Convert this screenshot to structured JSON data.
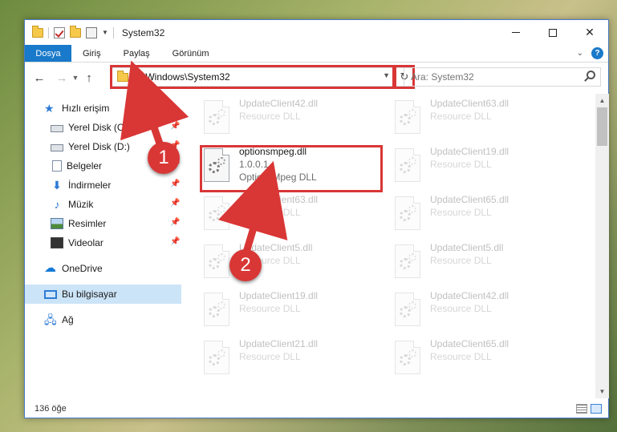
{
  "window": {
    "title": "System32"
  },
  "ribbon": {
    "tabs": [
      "Dosya",
      "Giriş",
      "Paylaş",
      "Görünüm"
    ],
    "help": "?"
  },
  "address": {
    "path": "C:\\Windows\\System32"
  },
  "search": {
    "placeholder": "Ara: System32"
  },
  "sidebar": {
    "items": [
      {
        "label": "Hızlı erişim",
        "icon": "star-icon"
      },
      {
        "label": "Yerel Disk (C:)",
        "icon": "disk-icon",
        "pinned": true
      },
      {
        "label": "Yerel Disk (D:)",
        "icon": "disk-icon",
        "pinned": true
      },
      {
        "label": "Belgeler",
        "icon": "document-icon",
        "pinned": true
      },
      {
        "label": "İndirmeler",
        "icon": "download-icon",
        "pinned": true
      },
      {
        "label": "Müzik",
        "icon": "music-icon",
        "pinned": true
      },
      {
        "label": "Resimler",
        "icon": "pictures-icon",
        "pinned": true
      },
      {
        "label": "Videolar",
        "icon": "video-icon",
        "pinned": true
      },
      {
        "label": "OneDrive",
        "icon": "cloud-icon"
      },
      {
        "label": "Bu bilgisayar",
        "icon": "computer-icon",
        "selected": true
      },
      {
        "label": "Ağ",
        "icon": "network-icon"
      }
    ]
  },
  "files": {
    "left": [
      {
        "name": "UpdateClient42.dll",
        "type": "Resource DLL"
      },
      {
        "name": "optionsmpeg.dll",
        "version": "1.0.0.1",
        "type": "OptionsMpeg DLL",
        "highlighted": true
      },
      {
        "name": "UpdateClient63.dll",
        "type": "Resource DLL"
      },
      {
        "name": "UpdateClient5.dll",
        "type": "Resource DLL"
      },
      {
        "name": "UpdateClient19.dll",
        "type": "Resource DLL"
      },
      {
        "name": "UpdateClient21.dll",
        "type": "Resource DLL"
      }
    ],
    "right": [
      {
        "name": "UpdateClient63.dll",
        "type": "Resource DLL"
      },
      {
        "name": "UpdateClient19.dll",
        "type": "Resource DLL"
      },
      {
        "name": "UpdateClient65.dll",
        "type": "Resource DLL"
      },
      {
        "name": "UpdateClient5.dll",
        "type": "Resource DLL"
      },
      {
        "name": "UpdateClient42.dll",
        "type": "Resource DLL"
      },
      {
        "name": "UpdateClient65.dll",
        "type": "Resource DLL"
      }
    ]
  },
  "status": {
    "count": "136 öğe"
  },
  "annotations": {
    "step1": "1",
    "step2": "2"
  },
  "colors": {
    "accent": "#1979ca",
    "highlight": "#d93636",
    "selected": "#cce4f7"
  }
}
